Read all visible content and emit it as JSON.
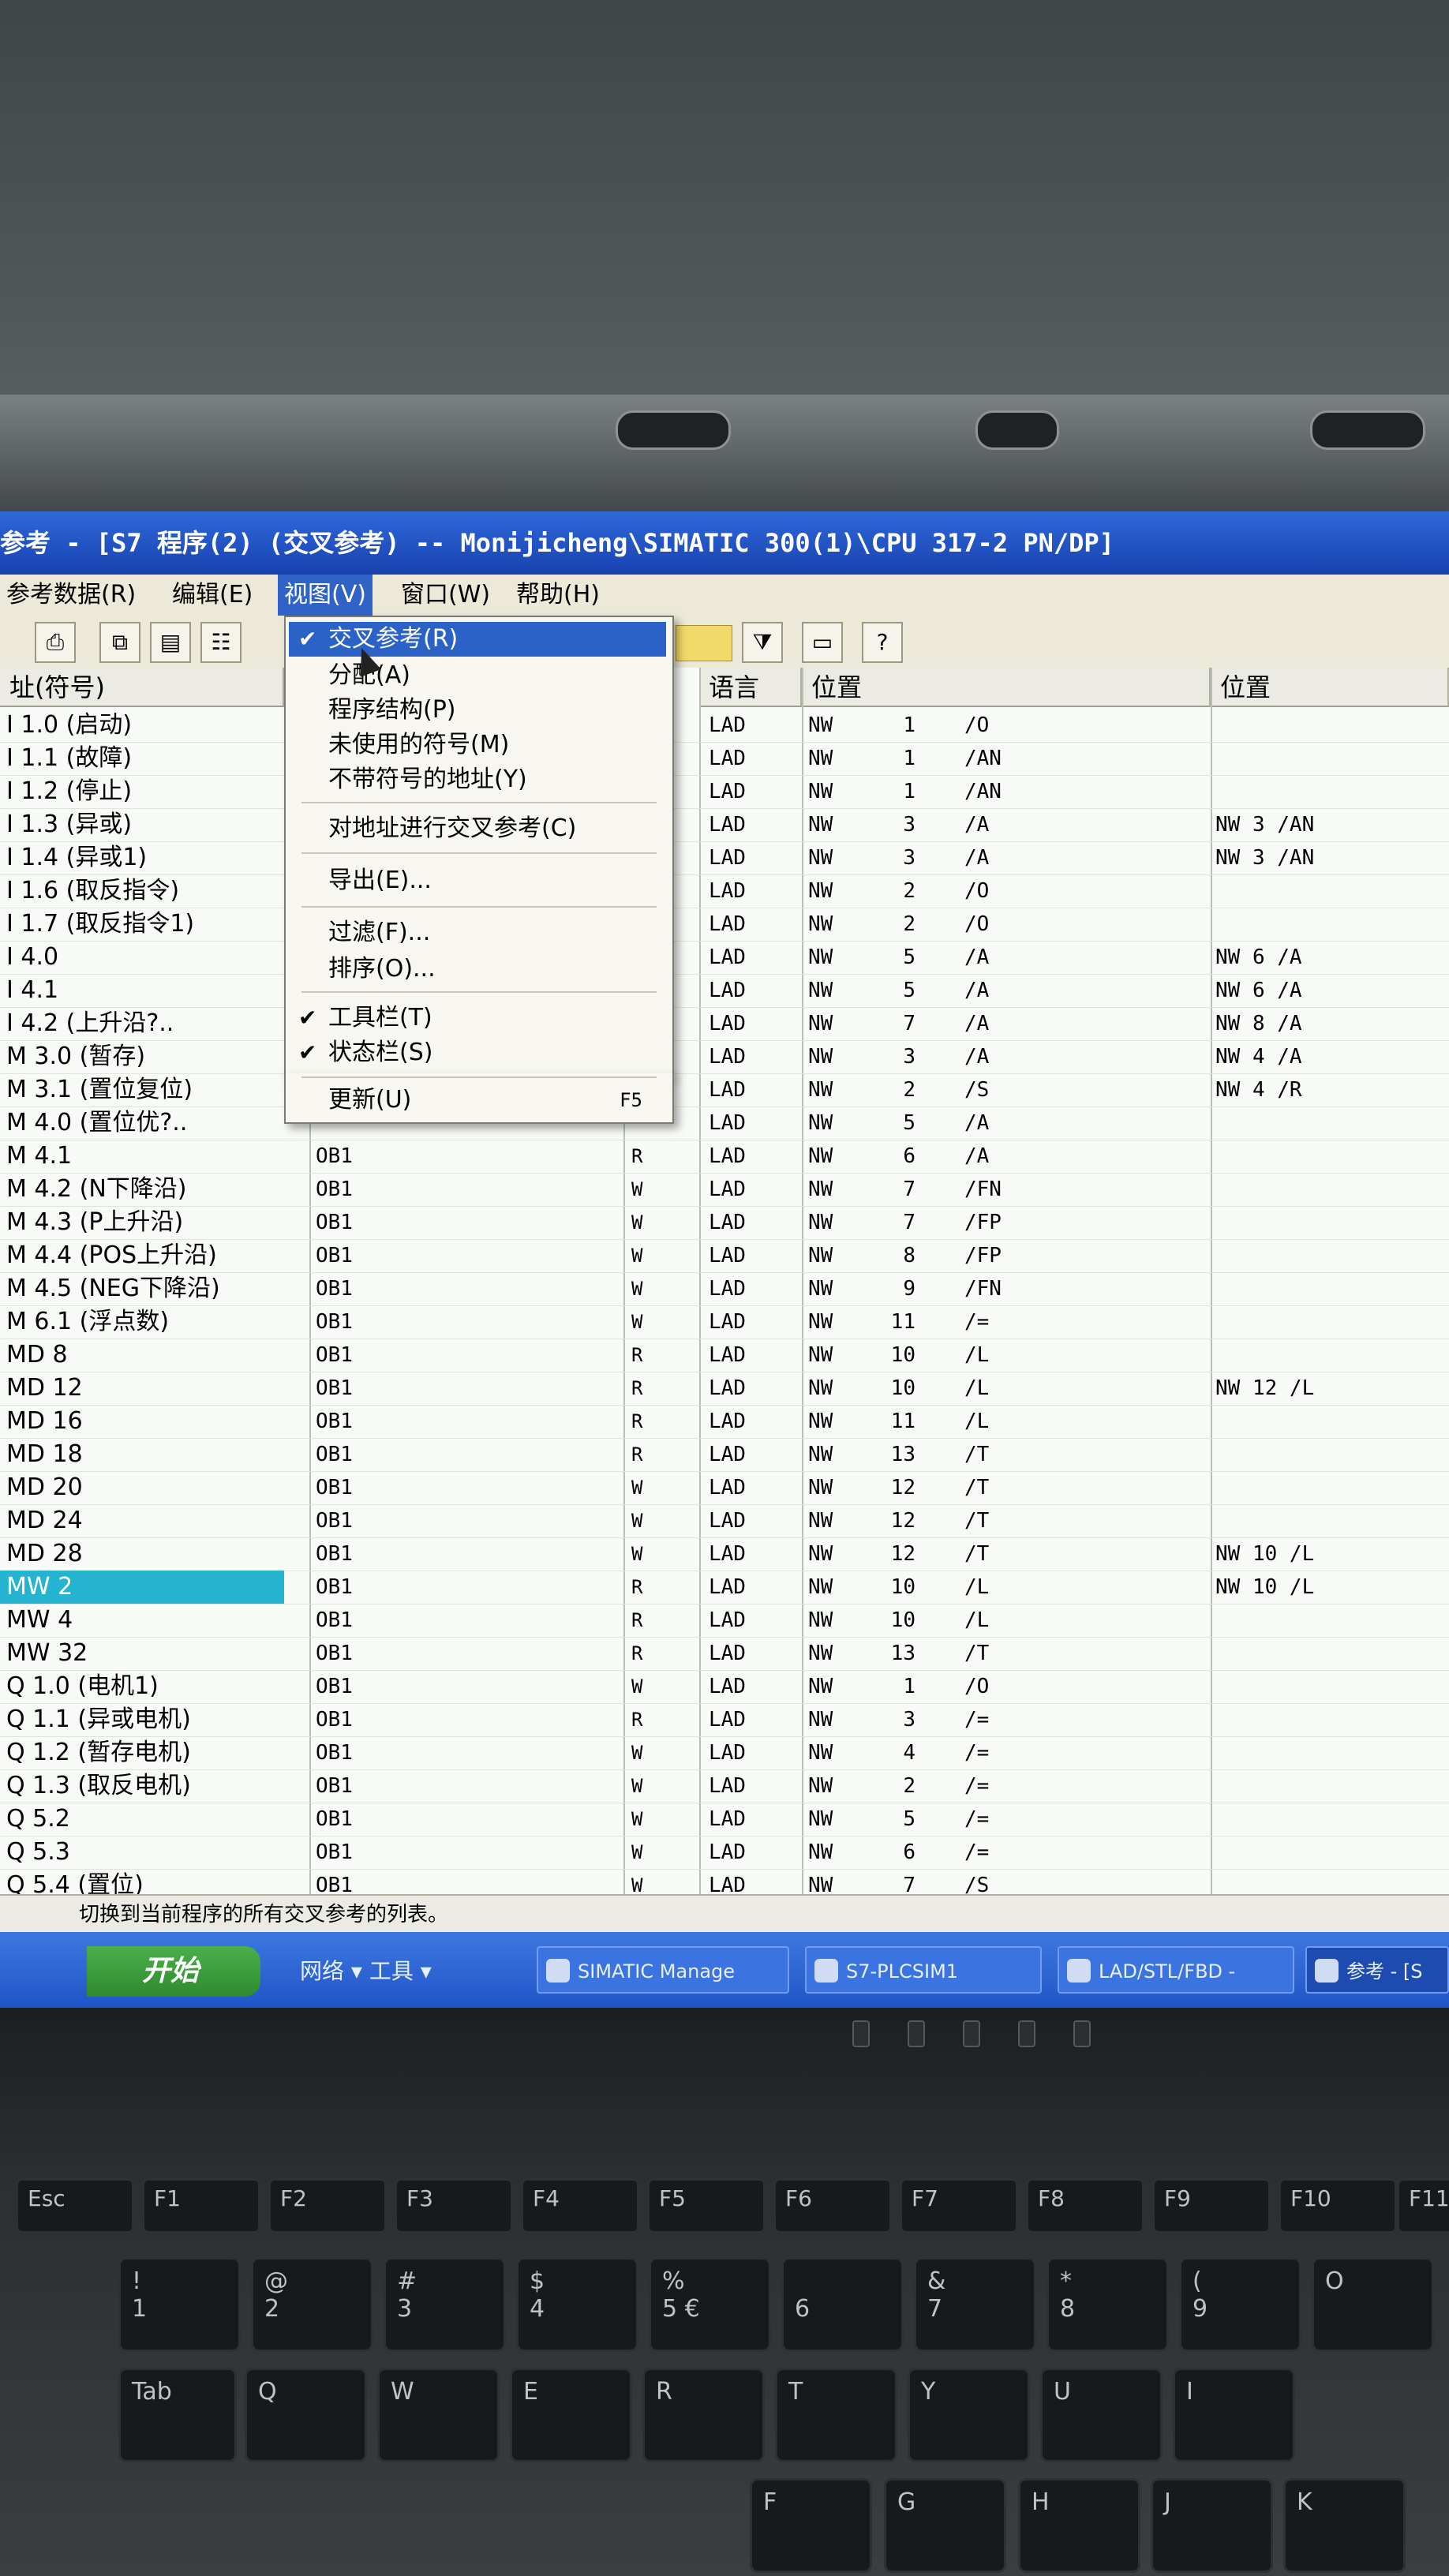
{
  "window": {
    "title": "参考 - [S7 程序(2) (交叉参考) -- Monijicheng\\SIMATIC 300(1)\\CPU 317-2 PN/DP]"
  },
  "menubar": {
    "items": [
      "参考数据(R)",
      "编辑(E)",
      "视图(V)",
      "窗口(W)",
      "帮助(H)"
    ],
    "active": "视图(V)"
  },
  "view_menu": {
    "items": [
      {
        "label": "交叉参考(R)",
        "checked": true,
        "highlighted": true
      },
      {
        "label": "分配(A)"
      },
      {
        "label": "程序结构(P)"
      },
      {
        "label": "未使用的符号(M)"
      },
      {
        "label": "不带符号的地址(Y)"
      },
      {
        "label": "对地址进行交叉参考(C)"
      },
      {
        "label": "导出(E)..."
      },
      {
        "label": "过滤(F)..."
      },
      {
        "label": "排序(O)..."
      },
      {
        "label": "工具栏(T)",
        "checked": true
      },
      {
        "label": "状态栏(S)",
        "checked": true
      },
      {
        "label": "更新(U)",
        "shortcut": "F5"
      }
    ]
  },
  "table": {
    "headers": {
      "address": "址(符号)",
      "language": "语言",
      "location": "位置",
      "location2": "位置"
    },
    "rows": [
      {
        "sym": "I 1.0 (启动)",
        "blk": "",
        "rw": "",
        "lang": "LAD",
        "nw": "NW",
        "num": "1",
        "op": "/O",
        "loc2": ""
      },
      {
        "sym": "I 1.1 (故障)",
        "blk": "",
        "rw": "",
        "lang": "LAD",
        "nw": "NW",
        "num": "1",
        "op": "/AN",
        "loc2": ""
      },
      {
        "sym": "I 1.2 (停止)",
        "blk": "",
        "rw": "",
        "lang": "LAD",
        "nw": "NW",
        "num": "1",
        "op": "/AN",
        "loc2": ""
      },
      {
        "sym": "I 1.3 (异或)",
        "blk": "",
        "rw": "",
        "lang": "LAD",
        "nw": "NW",
        "num": "3",
        "op": "/A",
        "loc2": "NW    3     /AN"
      },
      {
        "sym": "I 1.4 (异或1)",
        "blk": "",
        "rw": "",
        "lang": "LAD",
        "nw": "NW",
        "num": "3",
        "op": "/A",
        "loc2": "NW    3     /AN"
      },
      {
        "sym": "I 1.6 (取反指令)",
        "blk": "",
        "rw": "",
        "lang": "LAD",
        "nw": "NW",
        "num": "2",
        "op": "/O",
        "loc2": ""
      },
      {
        "sym": "I 1.7 (取反指令1)",
        "blk": "",
        "rw": "",
        "lang": "LAD",
        "nw": "NW",
        "num": "2",
        "op": "/O",
        "loc2": ""
      },
      {
        "sym": "I 4.0",
        "blk": "",
        "rw": "",
        "lang": "LAD",
        "nw": "NW",
        "num": "5",
        "op": "/A",
        "loc2": "NW    6     /A"
      },
      {
        "sym": "I 4.1",
        "blk": "",
        "rw": "",
        "lang": "LAD",
        "nw": "NW",
        "num": "5",
        "op": "/A",
        "loc2": "NW    6     /A"
      },
      {
        "sym": "I 4.2 (上升沿?..",
        "blk": "",
        "rw": "",
        "lang": "LAD",
        "nw": "NW",
        "num": "7",
        "op": "/A",
        "loc2": "NW    8     /A"
      },
      {
        "sym": "M 3.0 (暂存)",
        "blk": "",
        "rw": "",
        "lang": "LAD",
        "nw": "NW",
        "num": "3",
        "op": "/A",
        "loc2": "NW    4     /A"
      },
      {
        "sym": "M 3.1 (置位复位)",
        "blk": "",
        "rw": "",
        "lang": "LAD",
        "nw": "NW",
        "num": "2",
        "op": "/S",
        "loc2": "NW    4     /R"
      },
      {
        "sym": "M 4.0 (置位优?..",
        "blk": "",
        "rw": "",
        "lang": "LAD",
        "nw": "NW",
        "num": "5",
        "op": "/A",
        "loc2": ""
      },
      {
        "sym": "M 4.1",
        "blk": "OB1",
        "rw": "R",
        "lang": "LAD",
        "nw": "NW",
        "num": "6",
        "op": "/A",
        "loc2": ""
      },
      {
        "sym": "M 4.2 (N下降沿)",
        "blk": "OB1",
        "rw": "W",
        "lang": "LAD",
        "nw": "NW",
        "num": "7",
        "op": "/FN",
        "loc2": ""
      },
      {
        "sym": "M 4.3 (P上升沿)",
        "blk": "OB1",
        "rw": "W",
        "lang": "LAD",
        "nw": "NW",
        "num": "7",
        "op": "/FP",
        "loc2": ""
      },
      {
        "sym": "M 4.4 (POS上升沿)",
        "blk": "OB1",
        "rw": "W",
        "lang": "LAD",
        "nw": "NW",
        "num": "8",
        "op": "/FP",
        "loc2": ""
      },
      {
        "sym": "M 4.5 (NEG下降沿)",
        "blk": "OB1",
        "rw": "W",
        "lang": "LAD",
        "nw": "NW",
        "num": "9",
        "op": "/FN",
        "loc2": ""
      },
      {
        "sym": "M 6.1 (浮点数)",
        "blk": "OB1",
        "rw": "W",
        "lang": "LAD",
        "nw": "NW",
        "num": "11",
        "op": "/=",
        "loc2": ""
      },
      {
        "sym": "MD 8",
        "blk": "OB1",
        "rw": "R",
        "lang": "LAD",
        "nw": "NW",
        "num": "10",
        "op": "/L",
        "loc2": ""
      },
      {
        "sym": "MD 12",
        "blk": "OB1",
        "rw": "R",
        "lang": "LAD",
        "nw": "NW",
        "num": "10",
        "op": "/L",
        "loc2": "NW    12     /L"
      },
      {
        "sym": "MD 16",
        "blk": "OB1",
        "rw": "R",
        "lang": "LAD",
        "nw": "NW",
        "num": "11",
        "op": "/L",
        "loc2": ""
      },
      {
        "sym": "MD 18",
        "blk": "OB1",
        "rw": "R",
        "lang": "LAD",
        "nw": "NW",
        "num": "13",
        "op": "/T",
        "loc2": ""
      },
      {
        "sym": "MD 20",
        "blk": "OB1",
        "rw": "W",
        "lang": "LAD",
        "nw": "NW",
        "num": "12",
        "op": "/T",
        "loc2": ""
      },
      {
        "sym": "MD 24",
        "blk": "OB1",
        "rw": "W",
        "lang": "LAD",
        "nw": "NW",
        "num": "12",
        "op": "/T",
        "loc2": ""
      },
      {
        "sym": "MD 28",
        "blk": "OB1",
        "rw": "W",
        "lang": "LAD",
        "nw": "NW",
        "num": "12",
        "op": "/T",
        "loc2": "NW    10     /L"
      },
      {
        "sym": "MW 2",
        "blk": "OB1",
        "rw": "R",
        "lang": "LAD",
        "nw": "NW",
        "num": "10",
        "op": "/L",
        "loc2": "NW    10     /L",
        "selected": true
      },
      {
        "sym": "MW 4",
        "blk": "OB1",
        "rw": "R",
        "lang": "LAD",
        "nw": "NW",
        "num": "10",
        "op": "/L",
        "loc2": ""
      },
      {
        "sym": "MW 32",
        "blk": "OB1",
        "rw": "R",
        "lang": "LAD",
        "nw": "NW",
        "num": "13",
        "op": "/T",
        "loc2": ""
      },
      {
        "sym": "Q 1.0 (电机1)",
        "blk": "OB1",
        "rw": "W",
        "lang": "LAD",
        "nw": "NW",
        "num": "1",
        "op": "/O",
        "loc2": ""
      },
      {
        "sym": "Q 1.1 (异或电机)",
        "blk": "OB1",
        "rw": "R",
        "lang": "LAD",
        "nw": "NW",
        "num": "3",
        "op": "/=",
        "loc2": ""
      },
      {
        "sym": "Q 1.2 (暂存电机)",
        "blk": "OB1",
        "rw": "W",
        "lang": "LAD",
        "nw": "NW",
        "num": "4",
        "op": "/=",
        "loc2": ""
      },
      {
        "sym": "Q 1.3 (取反电机)",
        "blk": "OB1",
        "rw": "W",
        "lang": "LAD",
        "nw": "NW",
        "num": "2",
        "op": "/=",
        "loc2": ""
      },
      {
        "sym": "Q 5.2",
        "blk": "OB1",
        "rw": "W",
        "lang": "LAD",
        "nw": "NW",
        "num": "5",
        "op": "/=",
        "loc2": ""
      },
      {
        "sym": "Q 5.3",
        "blk": "OB1",
        "rw": "W",
        "lang": "LAD",
        "nw": "NW",
        "num": "6",
        "op": "/=",
        "loc2": ""
      },
      {
        "sym": "Q 5.4 (置位)",
        "blk": "OB1",
        "rw": "W",
        "lang": "LAD",
        "nw": "NW",
        "num": "7",
        "op": "/S",
        "loc2": ""
      }
    ]
  },
  "statusbar": {
    "text": "切换到当前程序的所有交叉参考的列表。"
  },
  "taskbar": {
    "start": "开始",
    "quicklaunch": "网络 ▾  工具 ▾",
    "buttons": [
      "SIMATIC Manage",
      "S7-PLCSIM1",
      "LAD/STL/FBD -",
      "参考 - [S"
    ]
  },
  "keyboard": {
    "fkeys": [
      "Esc",
      "F1",
      "F2",
      "F3",
      "F4",
      "F5",
      "F6",
      "F7",
      "F8",
      "F9",
      "F10",
      "F11"
    ],
    "numrow": [
      "!\n1",
      "@\n2",
      "#\n3",
      "$\n4",
      "%\n5 €",
      "\n6",
      "&\n7",
      "*\n8",
      "(\n9",
      "O"
    ],
    "qrow": [
      "Tab",
      "Q",
      "W",
      "E",
      "R",
      "T",
      "Y",
      "U",
      "I"
    ],
    "misc": [
      "H",
      "J",
      "K",
      "G",
      "F"
    ]
  }
}
